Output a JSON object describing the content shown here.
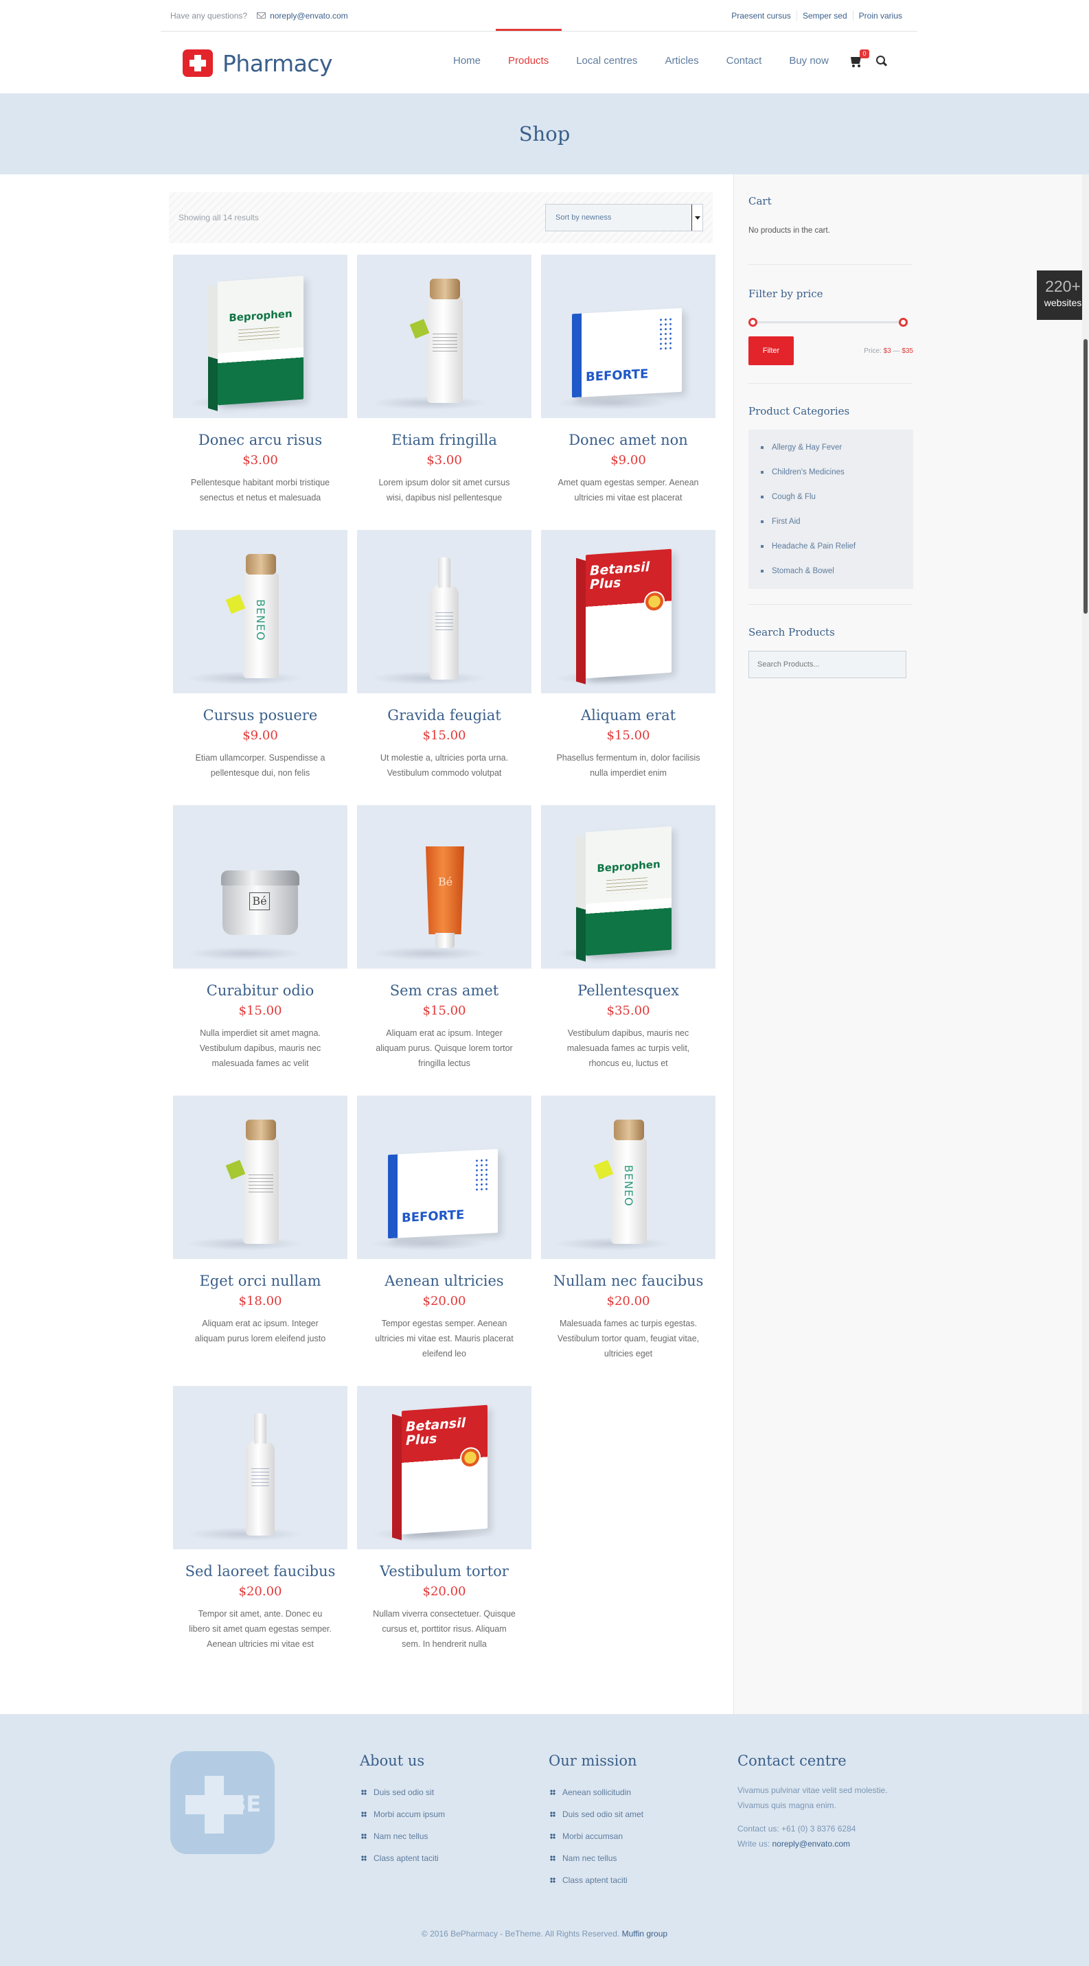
{
  "topbar": {
    "question": "Have any questions?",
    "email": "noreply@envato.com",
    "links": [
      "Praesent cursus",
      "Semper sed",
      "Proin varius"
    ]
  },
  "header": {
    "logo_text": "Pharmacy",
    "nav": [
      "Home",
      "Products",
      "Local centres",
      "Articles",
      "Contact",
      "Buy now"
    ],
    "active_nav": "Products",
    "cart_count": "0"
  },
  "page_title": "Shop",
  "toolbar": {
    "results": "Showing all 14 results",
    "sort_selected": "Sort by newness"
  },
  "products": [
    {
      "name": "Donec arcu risus",
      "price": "$3.00",
      "desc": "Pellentesque habitant morbi tristique senectus et netus et malesuada",
      "image": "beprophen-box"
    },
    {
      "name": "Etiam fringilla",
      "price": "$3.00",
      "desc": "Lorem ipsum dolor sit amet cursus wisi, dapibus nisl pellentesque",
      "image": "white-bottle"
    },
    {
      "name": "Donec amet non",
      "price": "$9.00",
      "desc": "Amet quam egestas semper. Aenean ultricies mi vitae est placerat",
      "image": "beforte-box"
    },
    {
      "name": "Cursus posuere",
      "price": "$9.00",
      "desc": "Etiam ullamcorper. Suspendisse a pellentesque dui, non felis",
      "image": "beneo-bottle"
    },
    {
      "name": "Gravida feugiat",
      "price": "$15.00",
      "desc": "Ut molestie a, ultricies porta urna. Vestibulum commodo volutpat",
      "image": "flask-bottle"
    },
    {
      "name": "Aliquam erat",
      "price": "$15.00",
      "desc": "Phasellus fermentum in, dolor facilisis nulla imperdiet enim",
      "image": "betansil-box"
    },
    {
      "name": "Curabitur odio",
      "price": "$15.00",
      "desc": "Nulla imperdiet sit amet magna. Vestibulum dapibus, mauris nec malesuada fames ac velit",
      "image": "cream-jar"
    },
    {
      "name": "Sem cras amet",
      "price": "$15.00",
      "desc": "Aliquam erat ac ipsum. Integer aliquam purus. Quisque lorem tortor fringilla lectus",
      "image": "orange-tube"
    },
    {
      "name": "Pellentesquex",
      "price": "$35.00",
      "desc": "Vestibulum dapibus, mauris nec malesuada fames ac turpis velit, rhoncus eu, luctus et",
      "image": "beprophen-box"
    },
    {
      "name": "Eget orci nullam",
      "price": "$18.00",
      "desc": "Aliquam erat ac ipsum. Integer aliquam purus lorem eleifend justo",
      "image": "white-bottle"
    },
    {
      "name": "Aenean ultricies",
      "price": "$20.00",
      "desc": "Tempor egestas semper. Aenean ultricies mi vitae est. Mauris placerat eleifend leo",
      "image": "beforte-box"
    },
    {
      "name": "Nullam nec faucibus",
      "price": "$20.00",
      "desc": "Malesuada fames ac turpis egestas. Vestibulum tortor quam, feugiat vitae, ultricies eget",
      "image": "beneo-bottle"
    },
    {
      "name": "Sed laoreet faucibus",
      "price": "$20.00",
      "desc": "Tempor sit amet, ante. Donec eu libero sit amet quam egestas semper. Aenean ultricies mi vitae est",
      "image": "flask-bottle"
    },
    {
      "name": "Vestibulum tortor",
      "price": "$20.00",
      "desc": "Nullam viverra consectetuer. Quisque cursus et, porttitor risus. Aliquam sem. In hendrerit nulla",
      "image": "betansil-box"
    }
  ],
  "product_art": {
    "beprophen": "Beprophen",
    "beforte": "BEFORTE",
    "betansil": "Betansil Plus",
    "beneo": "BENEO",
    "be": "Bé"
  },
  "sidebar": {
    "cart_title": "Cart",
    "cart_empty": "No products in the cart.",
    "price_title": "Filter by price",
    "filter_button": "Filter",
    "price_label": "Price:",
    "price_min": "$3",
    "price_max": "$35",
    "categories_title": "Product Categories",
    "categories": [
      "Allergy & Hay Fever",
      "Children's Medicines",
      "Cough & Flu",
      "First Aid",
      "Headache & Pain Relief",
      "Stomach & Bowel"
    ],
    "search_title": "Search Products",
    "search_placeholder": "Search Products..."
  },
  "side_badge": {
    "number": "220+",
    "label": "websites"
  },
  "footer": {
    "logo_text": "BE",
    "about_title": "About us",
    "about_links": [
      "Duis sed odio sit",
      "Morbi accum ipsum",
      "Nam nec tellus",
      "Class aptent taciti"
    ],
    "mission_title": "Our mission",
    "mission_links": [
      "Aenean sollicitudin",
      "Duis sed odio sit amet",
      "Morbi accumsan",
      "Nam nec tellus",
      "Class aptent taciti"
    ],
    "contact_title": "Contact centre",
    "contact_text": "Vivamus pulvinar vitae velit sed molestie. Vivamus quis magna enim.",
    "contact_phone": "Contact us: +61 (0) 3 8376 6284",
    "contact_write": "Write us:",
    "contact_email": "noreply@envato.com",
    "copyright": "© 2016 BePharmacy - BeTheme. All Rights Reserved.",
    "credit": "Muffin group"
  },
  "colors": {
    "accent": "#e23838",
    "brand_blue": "#3a5f8a",
    "band": "#dce6f0"
  }
}
